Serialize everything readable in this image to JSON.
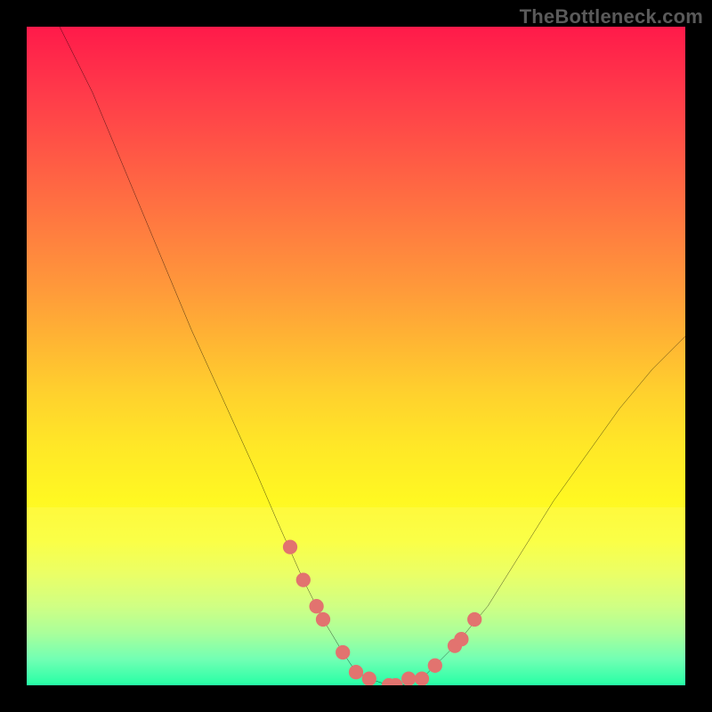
{
  "watermark": "TheBottleneck.com",
  "colors": {
    "frame": "#000000",
    "curve": "#000000",
    "marker": "#e2736f",
    "gradient_stops": [
      "#ff1a4a",
      "#ff3a4a",
      "#ff5a45",
      "#ff7a40",
      "#ff9a3a",
      "#ffb633",
      "#ffd22d",
      "#ffe827",
      "#fff822",
      "#faff30",
      "#e8ff55",
      "#c8ff78",
      "#9cff92",
      "#5affb0",
      "#00ffa0"
    ]
  },
  "chart_data": {
    "type": "line",
    "title": "",
    "xlabel": "",
    "ylabel": "",
    "xlim": [
      0,
      100
    ],
    "ylim": [
      0,
      100
    ],
    "grid": false,
    "legend": false,
    "series": [
      {
        "name": "bottleneck-curve",
        "x": [
          5,
          10,
          15,
          20,
          25,
          30,
          35,
          38,
          42,
          45,
          48,
          50,
          52,
          55,
          57,
          60,
          62,
          65,
          70,
          75,
          80,
          85,
          90,
          95,
          100
        ],
        "y": [
          100,
          90,
          78,
          66,
          54,
          43,
          32,
          25,
          16,
          10,
          5,
          2,
          1,
          0,
          0,
          1,
          3,
          6,
          12,
          20,
          28,
          35,
          42,
          48,
          53
        ]
      }
    ],
    "markers": {
      "name": "curve-markers",
      "x": [
        40,
        42,
        44,
        45,
        48,
        50,
        52,
        55,
        56,
        58,
        60,
        62,
        65,
        66,
        68
      ],
      "y": [
        21,
        16,
        12,
        10,
        5,
        2,
        1,
        0,
        0,
        1,
        1,
        3,
        6,
        7,
        10
      ]
    },
    "highlight_band_y": [
      0,
      27
    ]
  }
}
